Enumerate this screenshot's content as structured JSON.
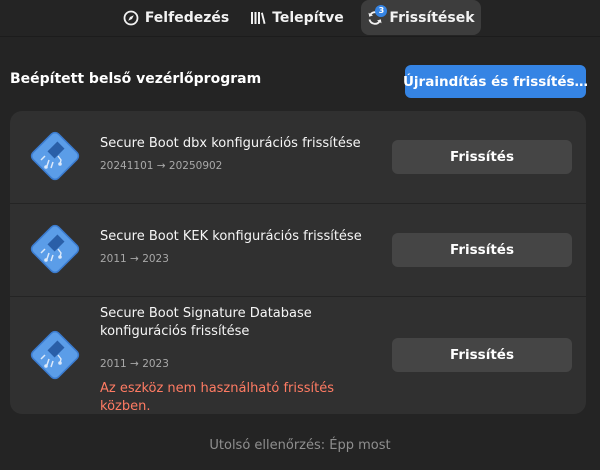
{
  "tabs": {
    "discover": {
      "label": "Felfedezés",
      "icon": "compass-icon"
    },
    "installed": {
      "label": "Telepítve",
      "icon": "library-icon"
    },
    "updates": {
      "label": "Frissítések",
      "icon": "refresh-icon",
      "badge": "3",
      "active": true
    }
  },
  "section": {
    "title": "Beépített belső vezérlőprogram",
    "restart_button": "Újraindítás és frissítés…"
  },
  "items": [
    {
      "title": "Secure Boot dbx konfigurációs frissítése",
      "version": "20241101 → 20250902",
      "warning": "",
      "button": "Frissítés",
      "icon": "firmware-chip-icon"
    },
    {
      "title": "Secure Boot KEK konfigurációs frissítése",
      "version": "2011 → 2023",
      "warning": "",
      "button": "Frissítés",
      "icon": "firmware-chip-icon"
    },
    {
      "title": "Secure Boot Signature Database konfigurációs frissítése",
      "version": "2011 → 2023",
      "warning": "Az eszköz nem használható frissítés közben.",
      "button": "Frissítés",
      "icon": "firmware-chip-icon"
    }
  ],
  "footer": {
    "last_checked": "Utolsó ellenőrzés: Épp most"
  },
  "colors": {
    "accent": "#3584e4",
    "background": "#242424",
    "card": "#303030",
    "warning": "#ff7b63"
  }
}
